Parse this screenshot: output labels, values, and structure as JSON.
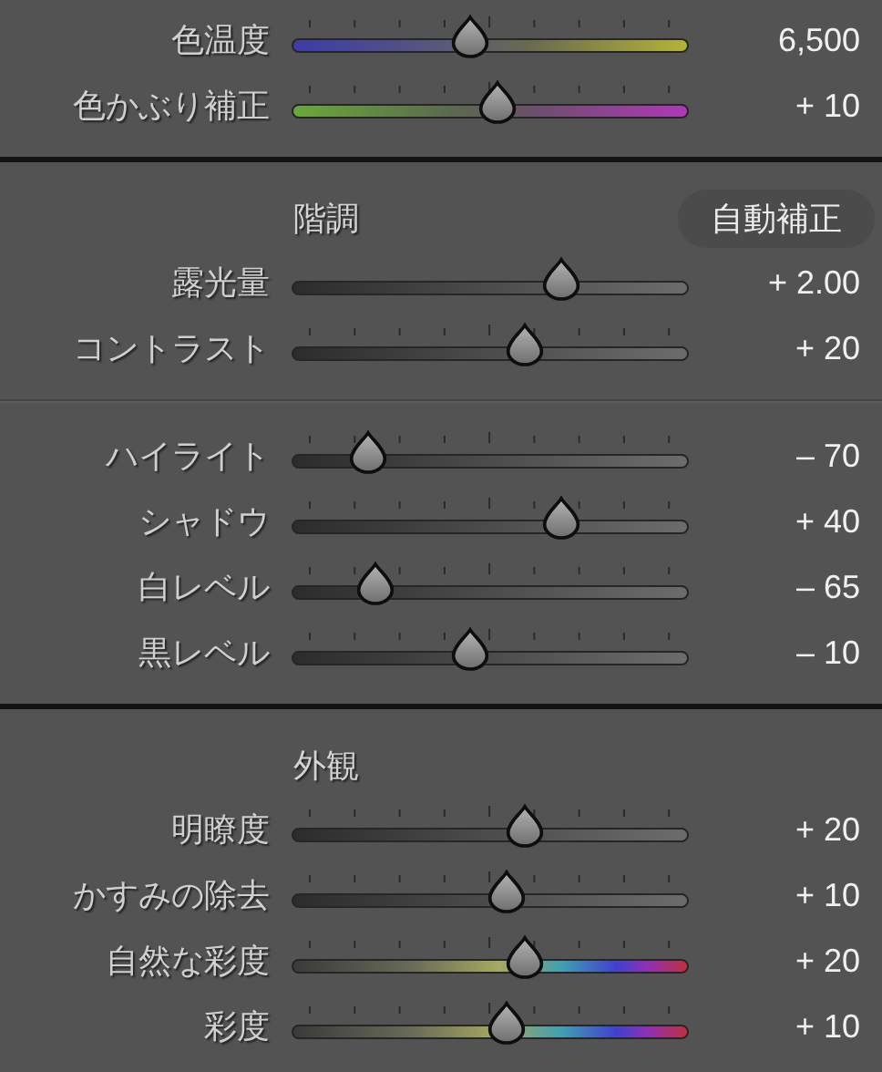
{
  "sections": [
    {
      "kind": "top",
      "sliders": [
        {
          "label": "色温度",
          "kind": "temp",
          "ticks": true,
          "level": 0.45,
          "reading": "6,500"
        },
        {
          "label": "色かぶり補正",
          "kind": "tint",
          "ticks": true,
          "level": 0.52,
          "reading": "+ 10"
        }
      ]
    },
    {
      "kind": "group",
      "title": "階調",
      "auto_button": "自動補正",
      "sliders": [
        {
          "label": "露光量",
          "kind": "plain",
          "ticks": false,
          "level": 0.68,
          "reading": "+ 2.00"
        },
        {
          "label": "コントラスト",
          "kind": "plain",
          "ticks": true,
          "level": 0.59,
          "reading": "+ 20"
        }
      ]
    },
    {
      "kind": "subgroup",
      "sliders": [
        {
          "label": "ハイライト",
          "kind": "plain",
          "ticks": true,
          "level": 0.19,
          "reading": "– 70"
        },
        {
          "label": "シャドウ",
          "kind": "plain",
          "ticks": true,
          "level": 0.68,
          "reading": "+ 40"
        },
        {
          "label": "白レベル",
          "kind": "plain",
          "ticks": true,
          "level": 0.21,
          "reading": "– 65"
        },
        {
          "label": "黒レベル",
          "kind": "plain",
          "ticks": true,
          "level": 0.45,
          "reading": "– 10"
        }
      ]
    },
    {
      "kind": "group",
      "title": "外観",
      "sliders": [
        {
          "label": "明瞭度",
          "kind": "plain",
          "ticks": true,
          "level": 0.59,
          "reading": "+ 20"
        },
        {
          "label": "かすみの除去",
          "kind": "plain",
          "ticks": true,
          "level": 0.54,
          "reading": "+ 10"
        },
        {
          "label": "自然な彩度",
          "kind": "color",
          "ticks": true,
          "level": 0.59,
          "reading": "+ 20"
        },
        {
          "label": "彩度",
          "kind": "color",
          "ticks": true,
          "level": 0.54,
          "reading": "+ 10"
        }
      ]
    }
  ]
}
